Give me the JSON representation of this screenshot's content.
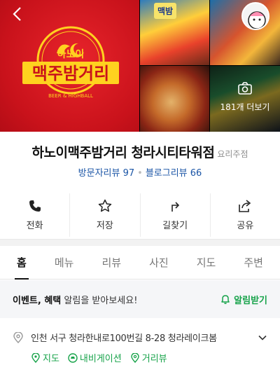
{
  "photos": {
    "logo": {
      "top_text": "하노이",
      "main_text": "맥주밤거리",
      "sub_text": "BEER & HIGHBALL"
    },
    "thumb1_sign": "맥밤",
    "more_photos_label": "181개 더보기"
  },
  "place": {
    "name": "하노이맥주밤거리 청라시티타워점",
    "category": "요리주점",
    "visitor_reviews": "방문자리뷰 97",
    "blog_reviews": "블로그리뷰 66"
  },
  "actions": [
    {
      "label": "전화",
      "icon": "phone-icon"
    },
    {
      "label": "저장",
      "icon": "star-icon"
    },
    {
      "label": "길찾기",
      "icon": "directions-icon"
    },
    {
      "label": "공유",
      "icon": "share-icon"
    }
  ],
  "tabs": [
    {
      "label": "홈",
      "active": true
    },
    {
      "label": "메뉴"
    },
    {
      "label": "리뷰"
    },
    {
      "label": "사진"
    },
    {
      "label": "지도"
    },
    {
      "label": "주변"
    }
  ],
  "event": {
    "bold_text": "이벤트, 혜택",
    "rest_text": " 알림을 받아보세요!",
    "button": "알림받기"
  },
  "address": {
    "text": "인천 서구 청라한내로100번길 8-28 청라레이크봄",
    "links": [
      "지도",
      "내비게이션",
      "거리뷰"
    ]
  },
  "colors": {
    "accent_green": "#17a34a",
    "link_blue": "#1b55a6",
    "logo_red": "#c9121b",
    "logo_yellow": "#ffd21f"
  }
}
